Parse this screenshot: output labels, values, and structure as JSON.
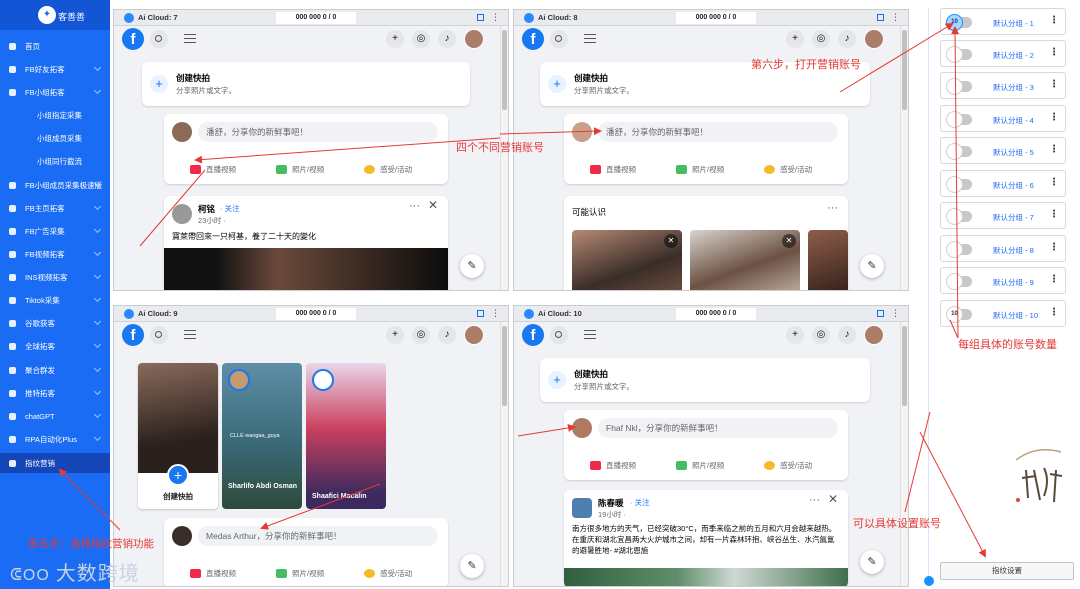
{
  "app": {
    "title": "客善善"
  },
  "sidebar": {
    "items": [
      {
        "label": "首页",
        "type": "main"
      },
      {
        "label": "FB好友拓客",
        "type": "main"
      },
      {
        "label": "FB小组拓客",
        "type": "main"
      },
      {
        "label": "小组指定采集",
        "type": "sub"
      },
      {
        "label": "小组成员采集",
        "type": "sub"
      },
      {
        "label": "小组同行截流",
        "type": "sub"
      },
      {
        "label": "FB小组成员采集极速版",
        "type": "main"
      },
      {
        "label": "FB主页拓客",
        "type": "main"
      },
      {
        "label": "FB广告采集",
        "type": "main"
      },
      {
        "label": "FB视频拓客",
        "type": "main"
      },
      {
        "label": "INS视频拓客",
        "type": "main"
      },
      {
        "label": "Tiktok采集",
        "type": "main"
      },
      {
        "label": "谷歌获客",
        "type": "main"
      },
      {
        "label": "全球拓客",
        "type": "main"
      },
      {
        "label": "聚合群发",
        "type": "main"
      },
      {
        "label": "推特拓客",
        "type": "main"
      },
      {
        "label": "chatGPT",
        "type": "main"
      },
      {
        "label": "RPA自动化Plus",
        "type": "main"
      },
      {
        "label": "指纹营销",
        "type": "main",
        "active": true
      }
    ]
  },
  "windows": [
    {
      "title": "Ai Cloud: 7",
      "stats": "000 000 0 / 0"
    },
    {
      "title": "Ai Cloud: 8",
      "stats": "000 000 0 / 0"
    },
    {
      "title": "Ai Cloud: 9",
      "stats": "000 000 0 / 0"
    },
    {
      "title": "Ai Cloud: 10",
      "stats": "000 000 0 / 0"
    }
  ],
  "fb": {
    "create_title": "创建快拍",
    "create_sub": "分享照片或文字。",
    "prompt_w1": "潘舒，分享你的新鲜事吧！",
    "prompt_w2": "潘舒，分享你的新鲜事吧！",
    "prompt_w3": "Medas Arthur，分享你的新鲜事吧！",
    "prompt_w4": "Fhaf Nkl，分享你的新鲜事吧！",
    "act_live": "直播视频",
    "act_photo": "照片/视频",
    "act_feel": "感受/活动",
    "post1_name": "柯铭",
    "post1_follow": "· 关注",
    "post1_time": "23小时 ·",
    "post1_text": "寶萊帶回來一只柯基，養了二十天的變化",
    "pymk_title": "可能认识",
    "story_create": "创建快拍",
    "story_user2": "Sharlifo Abdi Osman",
    "story_user3": "Shaafici Macalin",
    "story_tag": "CLLE wangaa_guya",
    "post2_name": "陈春暖",
    "post2_follow": "· 关注",
    "post2_time": "19小时 ·",
    "post2_text": "南方很多地方的天气，已经突破30°C，而季来临之前的五月和六月会越来越热。在重庆和湖北宜昌两大火炉城市之间，却有一片森林环抱、峡谷丛生、水汽氤氲的避暑胜地- #湖北恩施"
  },
  "right_panel": {
    "items": [
      {
        "num": "10",
        "label": "默认分组 - 1",
        "on": true
      },
      {
        "num": "",
        "label": "默认分组 - 2"
      },
      {
        "num": "",
        "label": "默认分组 - 3"
      },
      {
        "num": "",
        "label": "默认分组 - 4"
      },
      {
        "num": "",
        "label": "默认分组 - 5"
      },
      {
        "num": "",
        "label": "默认分组 - 6"
      },
      {
        "num": "",
        "label": "默认分组 - 7"
      },
      {
        "num": "",
        "label": "默认分组 - 8"
      },
      {
        "num": "",
        "label": "默认分组 - 9"
      },
      {
        "num": "10",
        "label": "默认分组 - 10"
      }
    ],
    "settings_btn": "指纹设置"
  },
  "annotations": {
    "a_step6": "第六步，打开营销账号",
    "a_four": "四个不同营销账号",
    "a_count": "每组具体的账号数量",
    "a_setting": "可以具体设置账号",
    "a_step5": "第五步：选择指纹营销功能"
  },
  "watermark": "大数跨境",
  "colors": {
    "sidebar": "#1b6cf5",
    "fb_blue": "#1877f2",
    "annotation_red": "#e53935"
  }
}
